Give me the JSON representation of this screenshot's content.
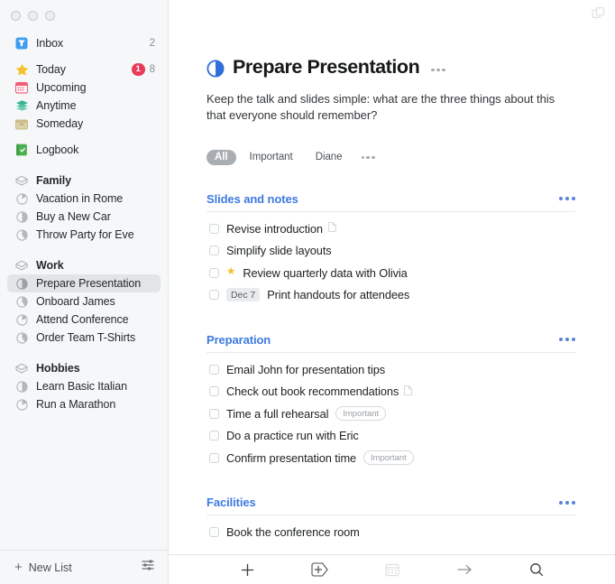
{
  "window": {
    "traffic_lights": [
      "close",
      "minimize",
      "zoom"
    ],
    "top_right_icon": "windows-copy-icon"
  },
  "sidebar": {
    "primary": [
      {
        "label": "Inbox",
        "icon": "inbox-tray-icon",
        "count": "2"
      },
      {
        "label": "Today",
        "icon": "star-icon",
        "badge": "1",
        "count": "8"
      },
      {
        "label": "Upcoming",
        "icon": "calendar-icon"
      },
      {
        "label": "Anytime",
        "icon": "layers-icon"
      },
      {
        "label": "Someday",
        "icon": "box-icon"
      },
      {
        "label": "Logbook",
        "icon": "logbook-icon"
      }
    ],
    "areas": [
      {
        "label": "Family",
        "icon": "area-box-icon",
        "projects": [
          {
            "label": "Vacation in Rome",
            "icon": "progress-circle-icon",
            "progress": 25
          },
          {
            "label": "Buy a New Car",
            "icon": "progress-circle-icon",
            "progress": 50
          },
          {
            "label": "Throw Party for Eve",
            "icon": "progress-circle-icon",
            "progress": 30
          }
        ]
      },
      {
        "label": "Work",
        "icon": "area-box-icon",
        "projects": [
          {
            "label": "Prepare Presentation",
            "icon": "progress-circle-icon",
            "progress": 50,
            "selected": true
          },
          {
            "label": "Onboard James",
            "icon": "progress-circle-icon",
            "progress": 30
          },
          {
            "label": "Attend Conference",
            "icon": "progress-circle-icon",
            "progress": 15
          },
          {
            "label": "Order Team T-Shirts",
            "icon": "progress-circle-icon",
            "progress": 30
          }
        ]
      },
      {
        "label": "Hobbies",
        "icon": "area-box-icon",
        "projects": [
          {
            "label": "Learn Basic Italian",
            "icon": "progress-circle-icon",
            "progress": 50
          },
          {
            "label": "Run a Marathon",
            "icon": "progress-circle-icon",
            "progress": 15
          }
        ]
      }
    ],
    "footer": {
      "new_list_label": "New List",
      "new_list_icon": "plus-icon",
      "settings_icon": "sliders-icon"
    }
  },
  "project": {
    "icon": "project-progress-icon",
    "title": "Prepare Presentation",
    "menu_icon": "ellipsis-icon",
    "notes": "Keep the talk and slides simple: what are the three things about this that everyone should remember?",
    "filters": [
      {
        "label": "All",
        "active": true
      },
      {
        "label": "Important",
        "active": false
      },
      {
        "label": "Diane",
        "active": false
      }
    ],
    "filters_more_icon": "ellipsis-icon"
  },
  "sections": [
    {
      "title": "Slides and notes",
      "menu_icon": "ellipsis-icon",
      "tasks": [
        {
          "text": "Revise introduction",
          "note_icon": "document-icon"
        },
        {
          "text": "Simplify slide layouts"
        },
        {
          "text": "Review quarterly data with Olivia",
          "star": "★"
        },
        {
          "text": "Print handouts for attendees",
          "date": "Dec 7"
        }
      ]
    },
    {
      "title": "Preparation",
      "menu_icon": "ellipsis-icon",
      "tasks": [
        {
          "text": "Email John for presentation tips"
        },
        {
          "text": "Check out book recommendations",
          "note_icon": "document-icon"
        },
        {
          "text": "Time a full rehearsal",
          "tag": "Important"
        },
        {
          "text": "Do a practice run with Eric"
        },
        {
          "text": "Confirm presentation time",
          "tag": "Important"
        }
      ]
    },
    {
      "title": "Facilities",
      "menu_icon": "ellipsis-icon",
      "tasks": [
        {
          "text": "Book the conference room"
        }
      ]
    }
  ],
  "bottom_bar": {
    "buttons": [
      {
        "name": "new-todo-button",
        "icon": "plus-icon"
      },
      {
        "name": "new-heading-button",
        "icon": "plus-in-tag-icon"
      },
      {
        "name": "when-button",
        "icon": "calendar-icon",
        "disabled": true
      },
      {
        "name": "move-button",
        "icon": "arrow-right-icon"
      },
      {
        "name": "search-button",
        "icon": "search-icon"
      }
    ]
  },
  "colors": {
    "accent_blue": "#3d7ae0",
    "sidebar_bg": "#f5f7f8",
    "badge_red": "#e93b5a",
    "star_yellow": "#f5c02a",
    "inbox_blue": "#3f9ef0",
    "anytime_teal": "#39b295",
    "someday_tan": "#d6c89a",
    "logbook_green": "#4cb050",
    "upcoming_pink": "#ef5f7a"
  }
}
